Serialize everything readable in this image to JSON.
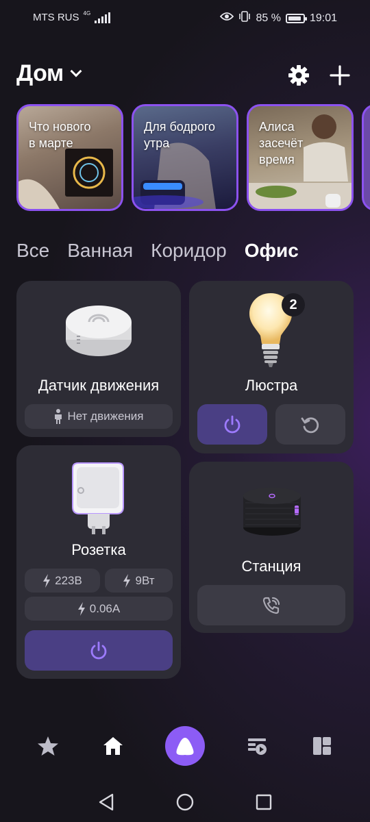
{
  "status_bar": {
    "carrier": "MTS RUS",
    "network": "4G",
    "battery_percent": "85 %",
    "time": "19:01"
  },
  "header": {
    "title": "Дом",
    "settings_icon": "gear-icon",
    "add_icon": "plus-icon"
  },
  "stories": [
    {
      "title": "Что нового\nв марте"
    },
    {
      "title": "Для бодрого\nутра"
    },
    {
      "title": "Алиса\nзасечёт\nвремя"
    }
  ],
  "rooms_tabs": [
    {
      "label": "Все",
      "active": false
    },
    {
      "label": "Ванная",
      "active": false
    },
    {
      "label": "Коридор",
      "active": false
    },
    {
      "label": "Офис",
      "active": true
    }
  ],
  "devices": {
    "motion_sensor": {
      "name": "Датчик движения",
      "status": "Нет движения"
    },
    "chandelier": {
      "name": "Люстра",
      "badge_count": "2",
      "power_icon": "power-icon",
      "reset_icon": "rotate-ccw-icon"
    },
    "socket": {
      "name": "Розетка",
      "voltage": "223В",
      "power": "9Вт",
      "current": "0.06А",
      "power_icon": "power-icon"
    },
    "station": {
      "name": "Станция",
      "call_icon": "phone-call-icon"
    }
  },
  "colors": {
    "accent": "#8c5cf5",
    "card_bg": "#2d2c35",
    "active_button_bg": "#4a3f84",
    "story_border": "#8c52f0"
  },
  "bottom_nav": [
    {
      "icon": "star-icon"
    },
    {
      "icon": "home-icon"
    },
    {
      "icon": "alice-icon"
    },
    {
      "icon": "media-playlist-icon"
    },
    {
      "icon": "dashboard-icon"
    }
  ]
}
